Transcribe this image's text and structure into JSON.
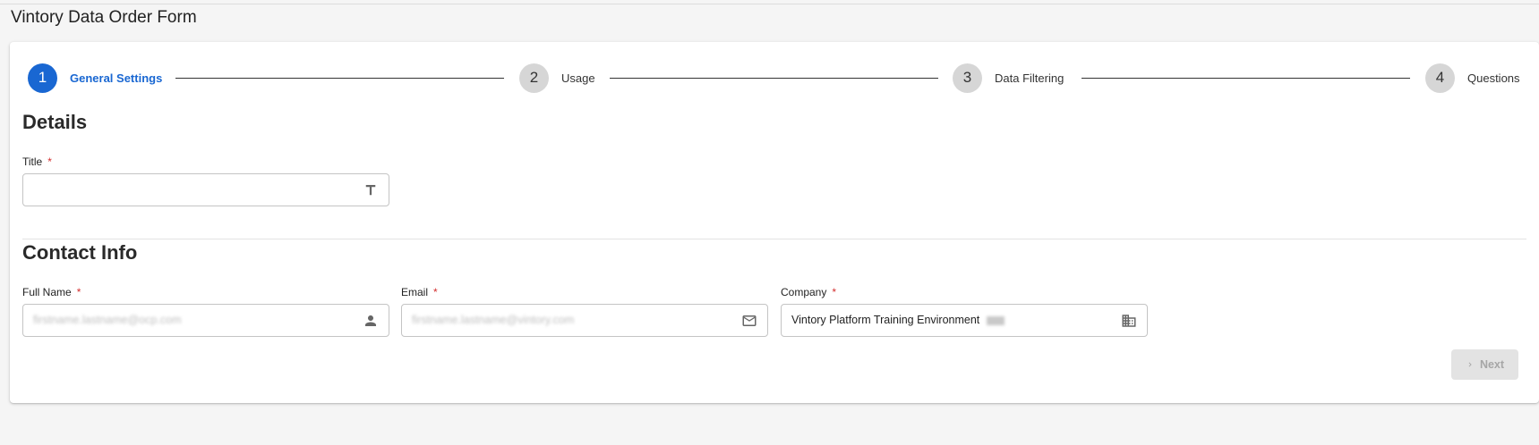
{
  "page": {
    "title": "Vintory Data Order Form"
  },
  "stepper": {
    "steps": [
      {
        "number": "1",
        "label": "General Settings",
        "active": true
      },
      {
        "number": "2",
        "label": "Usage",
        "active": false
      },
      {
        "number": "3",
        "label": "Data Filtering",
        "active": false
      },
      {
        "number": "4",
        "label": "Questions",
        "active": false
      }
    ]
  },
  "details": {
    "heading": "Details",
    "title_field": {
      "label": "Title",
      "required_mark": "*",
      "value": "",
      "icon": "text-format-icon"
    }
  },
  "contact": {
    "heading": "Contact Info",
    "full_name": {
      "label": "Full Name",
      "required_mark": "*",
      "value": "firstname.lastname@ocp.com",
      "icon": "person-icon"
    },
    "email": {
      "label": "Email",
      "required_mark": "*",
      "value": "firstname.lastname@vintory.com",
      "icon": "mail-icon"
    },
    "company": {
      "label": "Company",
      "required_mark": "*",
      "value": "Vintory Platform Training Environment",
      "icon": "building-icon"
    }
  },
  "actions": {
    "next_label": "Next"
  },
  "colors": {
    "accent": "#1967d2",
    "required": "#d32f2f",
    "inactive_step": "#d6d6d6"
  }
}
